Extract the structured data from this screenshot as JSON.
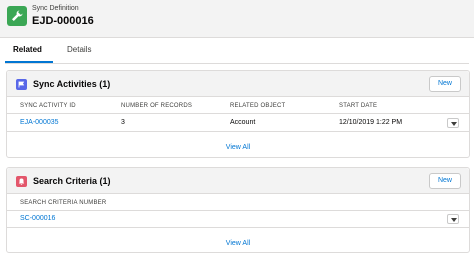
{
  "record": {
    "type_label": "Sync Definition",
    "name": "EJD-000016"
  },
  "tabs": [
    {
      "label": "Related",
      "active": true
    },
    {
      "label": "Details",
      "active": false
    }
  ],
  "sync_activities": {
    "title": "Sync Activities (1)",
    "new_label": "New",
    "columns": [
      "SYNC ACTIVITY ID",
      "NUMBER OF RECORDS",
      "RELATED OBJECT",
      "START DATE"
    ],
    "rows": [
      {
        "id": "EJA-000035",
        "records": "3",
        "object": "Account",
        "start": "12/10/2019 1:22 PM"
      }
    ],
    "view_all": "View All",
    "icon": "flag-icon",
    "icon_color": "#5867e8"
  },
  "search_criteria": {
    "title": "Search Criteria (1)",
    "new_label": "New",
    "columns": [
      "SEARCH CRITERIA NUMBER"
    ],
    "rows": [
      {
        "number": "SC-000016"
      }
    ],
    "view_all": "View All",
    "icon": "bell-icon",
    "icon_color": "#e3566b"
  },
  "colors": {
    "brand_icon": "#3ba755",
    "link": "#0176d3"
  }
}
